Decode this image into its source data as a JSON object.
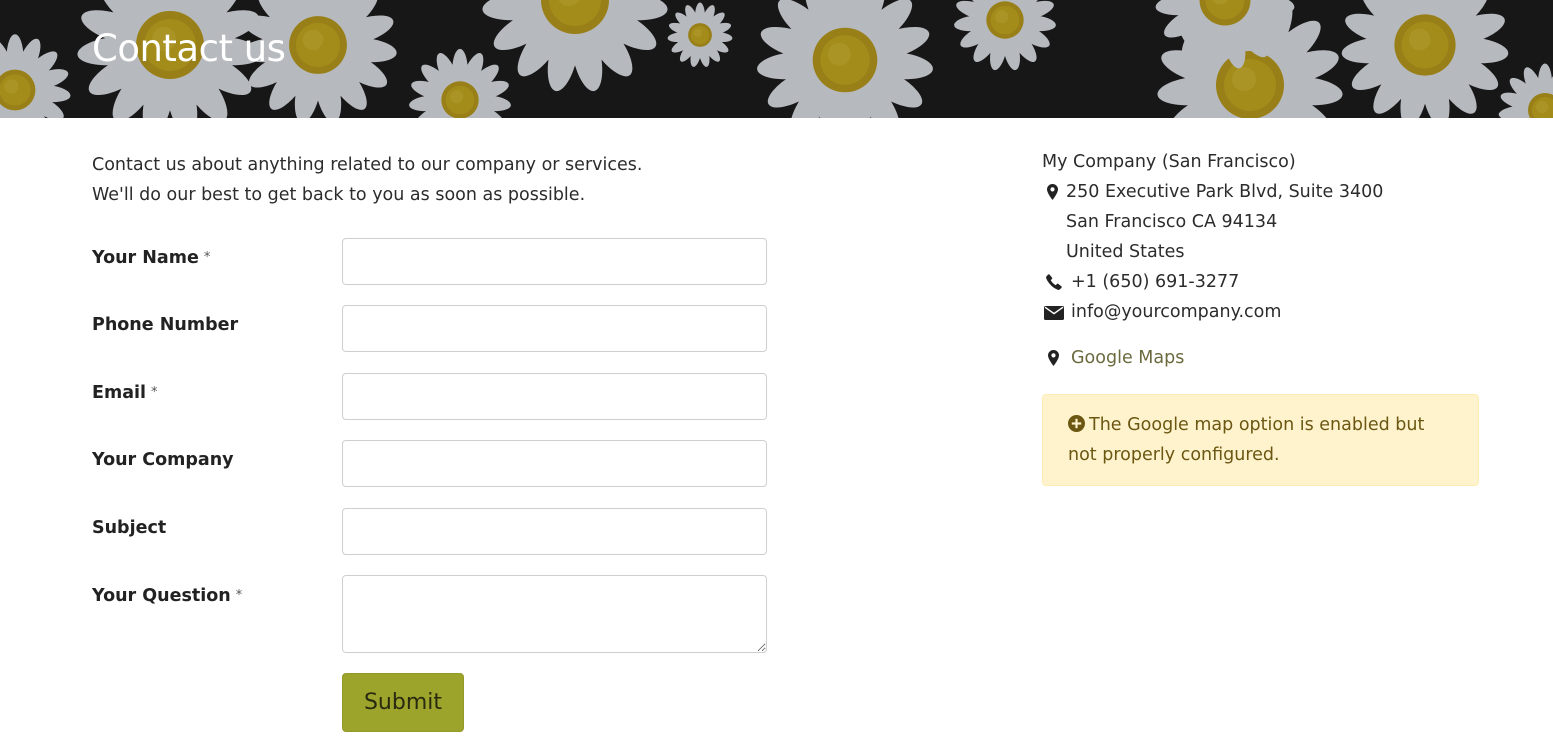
{
  "header": {
    "title": "Contact us"
  },
  "intro": {
    "line1": "Contact us about anything related to our company or services.",
    "line2": "We'll do our best to get back to you as soon as possible."
  },
  "form": {
    "required_mark": "*",
    "fields": [
      {
        "label": "Your Name",
        "required": true,
        "value": ""
      },
      {
        "label": "Phone Number",
        "required": false,
        "value": ""
      },
      {
        "label": "Email",
        "required": true,
        "value": ""
      },
      {
        "label": "Your Company",
        "required": false,
        "value": ""
      },
      {
        "label": "Subject",
        "required": false,
        "value": ""
      },
      {
        "label": "Your Question",
        "required": true,
        "value": ""
      }
    ],
    "submit_label": "Submit"
  },
  "company": {
    "name": "My Company (San Francisco)",
    "address_line1": "250 Executive Park Blvd, Suite 3400",
    "address_line2": "San Francisco CA 94134",
    "address_line3": "United States",
    "phone": "+1 (650) 691-3277",
    "email": "info@yourcompany.com",
    "maps_label": "Google Maps",
    "icons": {
      "address": "map-marker-icon",
      "phone": "phone-icon",
      "email": "envelope-icon",
      "maps": "map-marker-icon"
    }
  },
  "alert": {
    "icon": "plus-circle-icon",
    "text": "The Google map option is enabled but not properly configured."
  },
  "colors": {
    "accent": "#9ca42b",
    "link": "#6b6a3f",
    "alert_bg": "#fff3cd",
    "alert_text": "#6b5712"
  }
}
